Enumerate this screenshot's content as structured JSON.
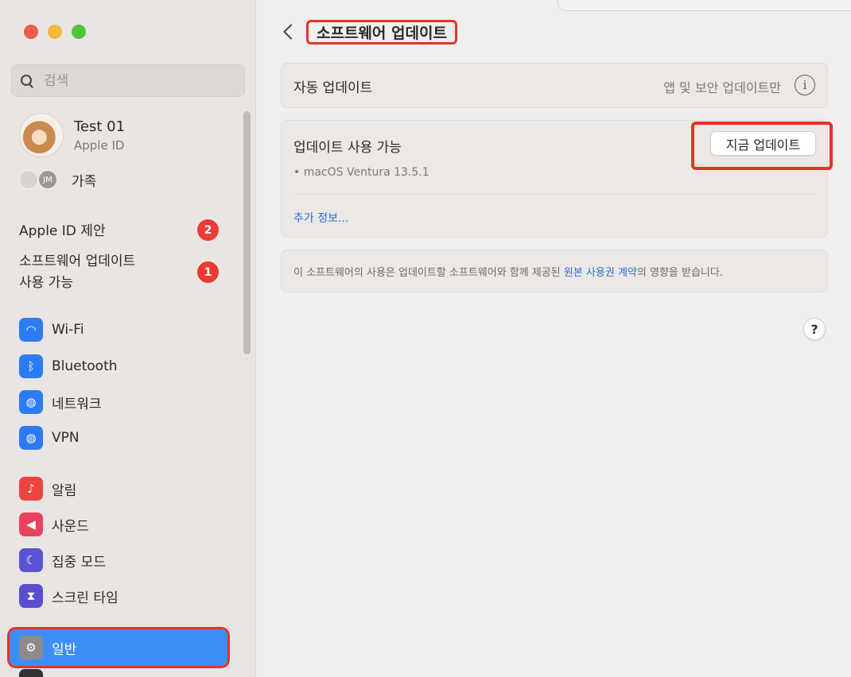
{
  "window": {
    "traffic_lights": [
      "close",
      "minimize",
      "zoom"
    ]
  },
  "sidebar": {
    "search_placeholder": "검색",
    "profile": {
      "name": "Test 01",
      "subtitle": "Apple ID"
    },
    "family": {
      "label": "가족",
      "avatar_initials": "JM"
    },
    "notices": [
      {
        "label": "Apple ID 제안",
        "badge": "2"
      },
      {
        "label_line1": "소프트웨어 업데이트",
        "label_line2": "사용 가능",
        "badge": "1"
      }
    ],
    "network_items": [
      {
        "label": "Wi-Fi",
        "icon": "wifi-icon",
        "glyph": "◠"
      },
      {
        "label": "Bluetooth",
        "icon": "bluetooth-icon",
        "glyph": "ᛒ"
      },
      {
        "label": "네트워크",
        "icon": "globe-icon",
        "glyph": "◍"
      },
      {
        "label": "VPN",
        "icon": "vpn-globe-icon",
        "glyph": "◍"
      }
    ],
    "system_items": [
      {
        "label": "알림",
        "icon": "bell-icon",
        "glyph": "♪"
      },
      {
        "label": "사운드",
        "icon": "speaker-icon",
        "glyph": "◀"
      },
      {
        "label": "집중 모드",
        "icon": "moon-icon",
        "glyph": "☾"
      },
      {
        "label": "스크린 타임",
        "icon": "hourglass-icon",
        "glyph": "⧗"
      }
    ],
    "selected_item": {
      "label": "일반",
      "icon": "gear-icon",
      "glyph": "⚙"
    }
  },
  "main": {
    "title": "소프트웨어 업데이트",
    "auto_update": {
      "label": "자동 업데이트",
      "value": "앱 및 보안 업데이트만",
      "info_glyph": "i"
    },
    "update_available": {
      "label": "업데이트 사용 가능",
      "version": "• macOS Ventura 13.5.1",
      "more_info": "추가 정보...",
      "button": "지금 업데이트"
    },
    "license": {
      "before": "이 소프트웨어의 사용은 업데이트할 소프트웨어와 함께 제공된 ",
      "link": "원본 사용권 계약",
      "after": "의 영향을 받습니다."
    },
    "help_glyph": "?"
  },
  "colors": {
    "accent_blue": "#3d8ef7",
    "highlight_red": "#e33428",
    "badge_red": "#ec3a35",
    "link_blue": "#2b6fd0"
  }
}
